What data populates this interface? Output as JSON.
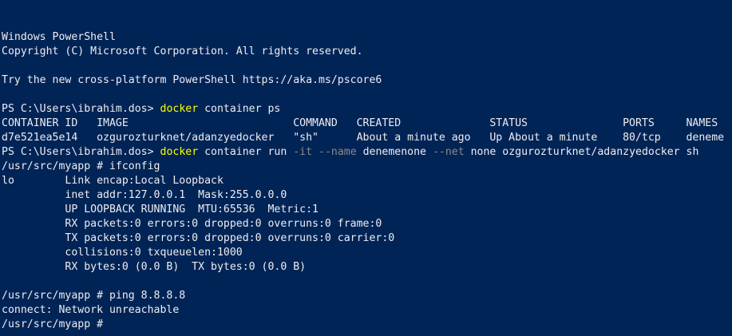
{
  "window_title": "Windows PowerShell",
  "colors": {
    "background": "#012456",
    "foreground": "#EEEDF0",
    "command": "#FFFF00",
    "parameter": "#8a8a8a"
  },
  "lines": [
    {
      "segments": [
        {
          "text": "Windows PowerShell",
          "style": "white"
        }
      ]
    },
    {
      "segments": [
        {
          "text": "Copyright (C) Microsoft Corporation. All rights reserved.",
          "style": "white"
        }
      ]
    },
    {
      "segments": [
        {
          "text": "",
          "style": "white"
        }
      ]
    },
    {
      "segments": [
        {
          "text": "Try the new cross-platform PowerShell https://aka.ms/pscore6",
          "style": "white"
        }
      ]
    },
    {
      "segments": [
        {
          "text": "",
          "style": "white"
        }
      ]
    },
    {
      "segments": [
        {
          "text": "PS C:\\Users\\ibrahim.dos> ",
          "style": "white"
        },
        {
          "text": "docker",
          "style": "yellow"
        },
        {
          "text": " container ps",
          "style": "white"
        }
      ]
    },
    {
      "segments": [
        {
          "text": "CONTAINER ID   IMAGE                          COMMAND   CREATED              STATUS               PORTS     NAMES",
          "style": "white"
        }
      ]
    },
    {
      "segments": [
        {
          "text": "d7e521ea5e14   ozgurozturknet/adanzyedocker   \"sh\"      About a minute ago   Up About a minute    80/tcp    deneme",
          "style": "white"
        }
      ]
    },
    {
      "segments": [
        {
          "text": "PS C:\\Users\\ibrahim.dos> ",
          "style": "white"
        },
        {
          "text": "docker",
          "style": "yellow"
        },
        {
          "text": " container run ",
          "style": "white"
        },
        {
          "text": "-it",
          "style": "gray"
        },
        {
          "text": " ",
          "style": "white"
        },
        {
          "text": "--name",
          "style": "gray"
        },
        {
          "text": " denemenone ",
          "style": "white"
        },
        {
          "text": "--net",
          "style": "gray"
        },
        {
          "text": " none ozgurozturknet/adanzyedocker sh",
          "style": "white"
        }
      ]
    },
    {
      "segments": [
        {
          "text": "/usr/src/myapp # ifconfig",
          "style": "white"
        }
      ]
    },
    {
      "segments": [
        {
          "text": "lo        Link encap:Local Loopback",
          "style": "white"
        }
      ]
    },
    {
      "segments": [
        {
          "text": "          inet addr:127.0.0.1  Mask:255.0.0.0",
          "style": "white"
        }
      ]
    },
    {
      "segments": [
        {
          "text": "          UP LOOPBACK RUNNING  MTU:65536  Metric:1",
          "style": "white"
        }
      ]
    },
    {
      "segments": [
        {
          "text": "          RX packets:0 errors:0 dropped:0 overruns:0 frame:0",
          "style": "white"
        }
      ]
    },
    {
      "segments": [
        {
          "text": "          TX packets:0 errors:0 dropped:0 overruns:0 carrier:0",
          "style": "white"
        }
      ]
    },
    {
      "segments": [
        {
          "text": "          collisions:0 txqueuelen:1000",
          "style": "white"
        }
      ]
    },
    {
      "segments": [
        {
          "text": "          RX bytes:0 (0.0 B)  TX bytes:0 (0.0 B)",
          "style": "white"
        }
      ]
    },
    {
      "segments": [
        {
          "text": "",
          "style": "white"
        }
      ]
    },
    {
      "segments": [
        {
          "text": "/usr/src/myapp # ping 8.8.8.8",
          "style": "white"
        }
      ]
    },
    {
      "segments": [
        {
          "text": "connect: Network unreachable",
          "style": "white"
        }
      ]
    },
    {
      "segments": [
        {
          "text": "/usr/src/myapp # ",
          "style": "white"
        }
      ]
    }
  ]
}
